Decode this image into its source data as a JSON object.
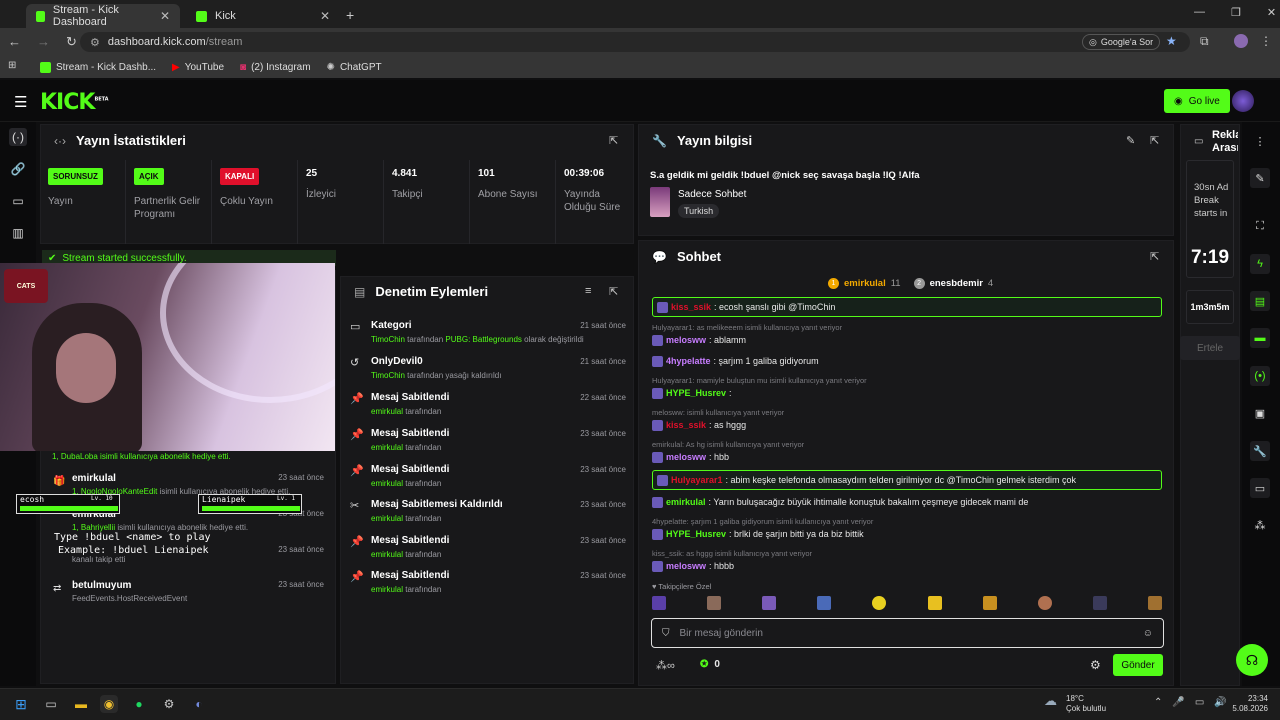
{
  "browser": {
    "tabs": [
      {
        "label": "Stream - Kick Dashboard"
      },
      {
        "label": "Kick"
      }
    ],
    "url_host": "dashboard.kick.com",
    "url_path": "/stream",
    "search_button": "Google'a Sor",
    "bookmarks": [
      {
        "label": "Stream - Kick Dashb..."
      },
      {
        "label": "YouTube"
      },
      {
        "label": "(2) Instagram"
      },
      {
        "label": "ChatGPT"
      }
    ]
  },
  "app": {
    "logo": "KICK",
    "logo_beta": "BETA",
    "go_live": "Go live"
  },
  "stats": {
    "title": "Yayın İstatistikleri",
    "items": [
      {
        "badge": "SORUNSUZ",
        "label": "Yayın",
        "badge_color": "#53fc18"
      },
      {
        "badge": "AÇIK",
        "label": "Partnerlik Gelir Programı",
        "badge_color": "#53fc18"
      },
      {
        "badge": "KAPALI",
        "label": "Çoklu Yayın",
        "badge_color": "#e0102b"
      },
      {
        "value": "25",
        "label": "İzleyici"
      },
      {
        "value": "4.841",
        "label": "Takipçi"
      },
      {
        "value": "101",
        "label": "Abone Sayısı"
      },
      {
        "value": "00:39:06",
        "label": "Yayında Olduğu Süre"
      }
    ],
    "success": "Stream started successfully."
  },
  "activity": [
    {
      "line1": "1, DubaLoba isimli kullanıcıya abonelik hediye etti."
    },
    {
      "title": "emirkulal",
      "sub_user": "1, NgoloNgoloKanteEdit",
      "sub": " isimli kullanıcıya abonelik hediye etti.",
      "time": "23 saat önce"
    },
    {
      "title": "emirkulal",
      "sub_user": "1, Bahriyellii",
      "sub": " isimli kullanıcıya abonelik hediye etti.",
      "time": "23 saat önce"
    },
    {
      "title": "",
      "sub": "kanalı takip etti",
      "time": "23 saat önce"
    },
    {
      "title": "betulmuyum",
      "sub": "FeedEvents.HostReceivedEvent",
      "time": "23 saat önce"
    }
  ],
  "overlay": {
    "ecosh": "ecosh",
    "ecosh_lv": "Lv. 10",
    "liena": "Lienaipek",
    "liena_lv": "Lv. 1",
    "cmd1": "Type !bduel <name> to play",
    "cmd2": "Example: !bduel Lienaipek"
  },
  "moderation": {
    "title": "Denetim Eylemleri",
    "items": [
      {
        "title": "Kategori",
        "user": "TimoChin",
        "text": " tarafından ",
        "extra": "PUBG: Battlegrounds",
        "text2": " olarak değiştirildi",
        "time": "21 saat önce"
      },
      {
        "title": "OnlyDevil0",
        "user": "TimoChin",
        "text": " tarafından yasağı kaldırıldı",
        "time": "21 saat önce"
      },
      {
        "title": "Mesaj Sabitlendi",
        "user": "emirkulal",
        "text": " tarafından",
        "time": "22 saat önce"
      },
      {
        "title": "Mesaj Sabitlendi",
        "user": "emirkulal",
        "text": " tarafından",
        "time": "23 saat önce"
      },
      {
        "title": "Mesaj Sabitlendi",
        "user": "emirkulal",
        "text": " tarafından",
        "time": "23 saat önce"
      },
      {
        "title": "Mesaj Sabitlemesi Kaldırıldı",
        "user": "emirkulal",
        "text": " tarafından",
        "time": "23 saat önce"
      },
      {
        "title": "Mesaj Sabitlendi",
        "user": "emirkulal",
        "text": " tarafından",
        "time": "23 saat önce"
      },
      {
        "title": "Mesaj Sabitlendi",
        "user": "emirkulal",
        "text": " tarafından",
        "time": "23 saat önce"
      }
    ]
  },
  "stream_info": {
    "title": "Yayın bilgisi",
    "stream_title": "S.a geldik mi geldik !bduel @nick seç savaşa başla !IQ !Alfa",
    "category": "Sadece Sohbet",
    "language": "Turkish"
  },
  "chat": {
    "title": "Sohbet",
    "top1": "emirkulal",
    "top1_n": "11",
    "top2": "enesbdemir",
    "top2_n": "4",
    "messages": [
      {
        "type": "msg",
        "user": "kiss_ssik",
        "text": ": ecosh şanslı gibi @TimoChin",
        "color": "#e0102b",
        "hl": true
      },
      {
        "type": "reply",
        "text": "Hulyayarar1: as melikeeem isimli kullanıcıya yanıt veriyor"
      },
      {
        "type": "msg",
        "user": "melosww",
        "text": ": ablamm",
        "color": "#c77dff"
      },
      {
        "type": "msg",
        "user": "4hypelatte",
        "text": ": şarjım 1 galiba gidiyorum",
        "color": "#c77dff"
      },
      {
        "type": "reply",
        "text": "Hulyayarar1: mamiyle buluştun mu isimli kullanıcıya yanıt veriyor"
      },
      {
        "type": "msg",
        "user": "HYPE_Husrev",
        "text": ":",
        "color": "#53fc18"
      },
      {
        "type": "reply",
        "text": "melosww:                              isimli kullanıcıya yanıt veriyor"
      },
      {
        "type": "msg",
        "user": "kiss_ssik",
        "text": ": as hggg",
        "color": "#e0102b"
      },
      {
        "type": "reply",
        "text": "emirkulal: As hg isimli kullanıcıya yanıt veriyor"
      },
      {
        "type": "msg",
        "user": "melosww",
        "text": ": hbb",
        "color": "#c77dff"
      },
      {
        "type": "msg",
        "user": "Hulyayarar1",
        "text": ": abim keşke telefonda olmasaydım telden girilmiyor dc @TimoChin gelmek isterdim çok",
        "color": "#e0102b",
        "hl": true
      },
      {
        "type": "msg",
        "user": "emirkulal",
        "text": ": Yarın buluşacağız büyük ihtimalle konuştuk bakalım çeşmeye gidecek mami de",
        "color": "#53fc18"
      },
      {
        "type": "reply",
        "text": "4hypelatte: şarjım 1 galiba gidiyorum             isimli kullanıcıya yanıt veriyor"
      },
      {
        "type": "msg",
        "user": "HYPE_Husrev",
        "text": ": brlki de şarjın bitti ya da biz bittik",
        "color": "#53fc18"
      },
      {
        "type": "reply",
        "text": "kiss_ssik: as hggg isimli kullanıcıya yanıt veriyor"
      },
      {
        "type": "msg",
        "user": "melosww",
        "text": ": hbbb",
        "color": "#c77dff"
      }
    ],
    "emote_label": "Takipçilere Özel",
    "placeholder": "Bir mesaj gönderin",
    "points": "0",
    "send": "Gönder"
  },
  "ad": {
    "title": "Reklam Arası",
    "text": "30sn Ad Break starts in",
    "timer": "7:19",
    "duration": "1m3m5m",
    "snooze": "Ertele"
  },
  "taskbar": {
    "weather_temp": "18°C",
    "weather_text": "Çok bulutlu",
    "time": "23:34",
    "date": "5.08.2026"
  }
}
